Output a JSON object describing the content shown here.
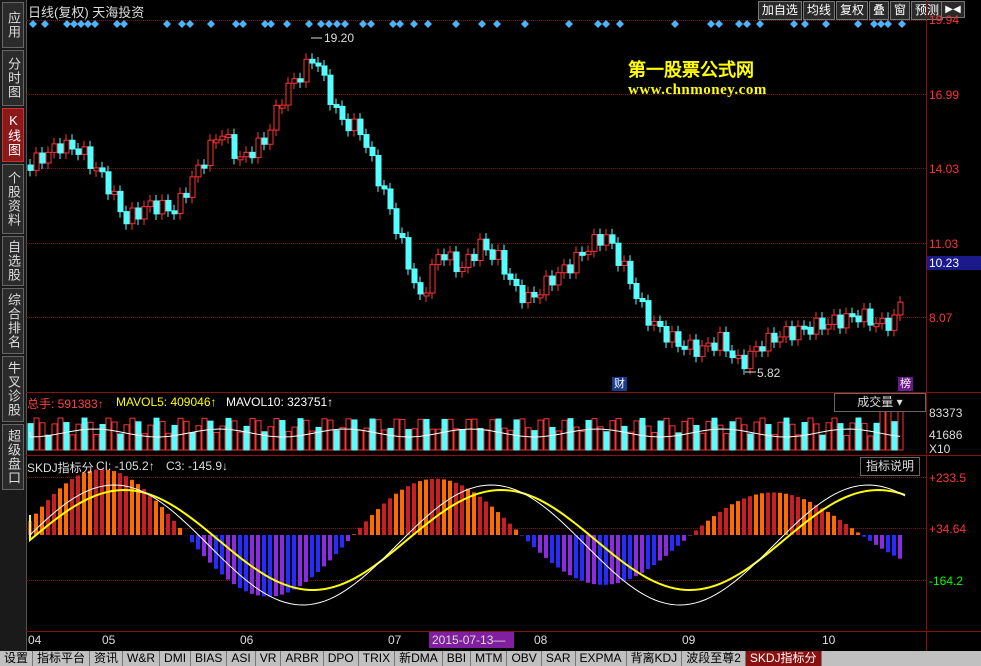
{
  "window": {
    "title": "日线(复权) 天海投资"
  },
  "sidebar": {
    "items": [
      {
        "label": "应用"
      },
      {
        "label": "分时图"
      },
      {
        "label": "K线图"
      },
      {
        "label": "个股资料"
      },
      {
        "label": "自选股"
      },
      {
        "label": "综合排名"
      },
      {
        "label": "牛叉诊股"
      },
      {
        "label": "超级盘口"
      }
    ]
  },
  "toolbar": {
    "buttons": [
      "加自选",
      "均线",
      "复权",
      "叠",
      "窗",
      "预测"
    ],
    "nav_arrows": "▶◀"
  },
  "price_axis": {
    "ticks": [
      "19.94",
      "16.99",
      "14.03",
      "11.03",
      "8.07"
    ],
    "current_price": "10.23"
  },
  "annotations": {
    "high": "19.20",
    "low": "5.82",
    "badge1": "财",
    "badge2": "榜"
  },
  "watermark": {
    "line1": "第一股票公式网",
    "line2": "www.chnmoney.com"
  },
  "volume": {
    "total_label": "总手: 591383↑",
    "mavol5_label": "MAVOL5: 409046↑",
    "mavol10_label": "MAVOL10: 323751↑",
    "selector": "成交量",
    "ticks": [
      "83373",
      "41686",
      "X10"
    ]
  },
  "indicator": {
    "name": "SKDJ指标分",
    "ci_label": "CI: -105.2↑",
    "c3_label": "C3: -145.9↓",
    "explain_button": "指标说明",
    "ticks": [
      "+233.5",
      "+34.64",
      "-164.2"
    ]
  },
  "date_axis": {
    "ticks": [
      "04",
      "05",
      "06",
      "07",
      "08",
      "09",
      "10"
    ],
    "cursor_date": "2015-07-13—"
  },
  "bottom_tabs": [
    "设置",
    "指标平台",
    "资讯",
    "W&R",
    "DMI",
    "BIAS",
    "ASI",
    "VR",
    "ARBR",
    "DPO",
    "TRIX",
    "新DMA",
    "BBI",
    "MTM",
    "OBV",
    "SAR",
    "EXPMA",
    "背离KDJ",
    "波段至尊2",
    "SKDJ指标分"
  ],
  "colors": {
    "up": "#ff3232",
    "down": "#54ffff",
    "ma": "#ffffff",
    "signal": "#ffff00",
    "grid": "#7a1010"
  }
}
